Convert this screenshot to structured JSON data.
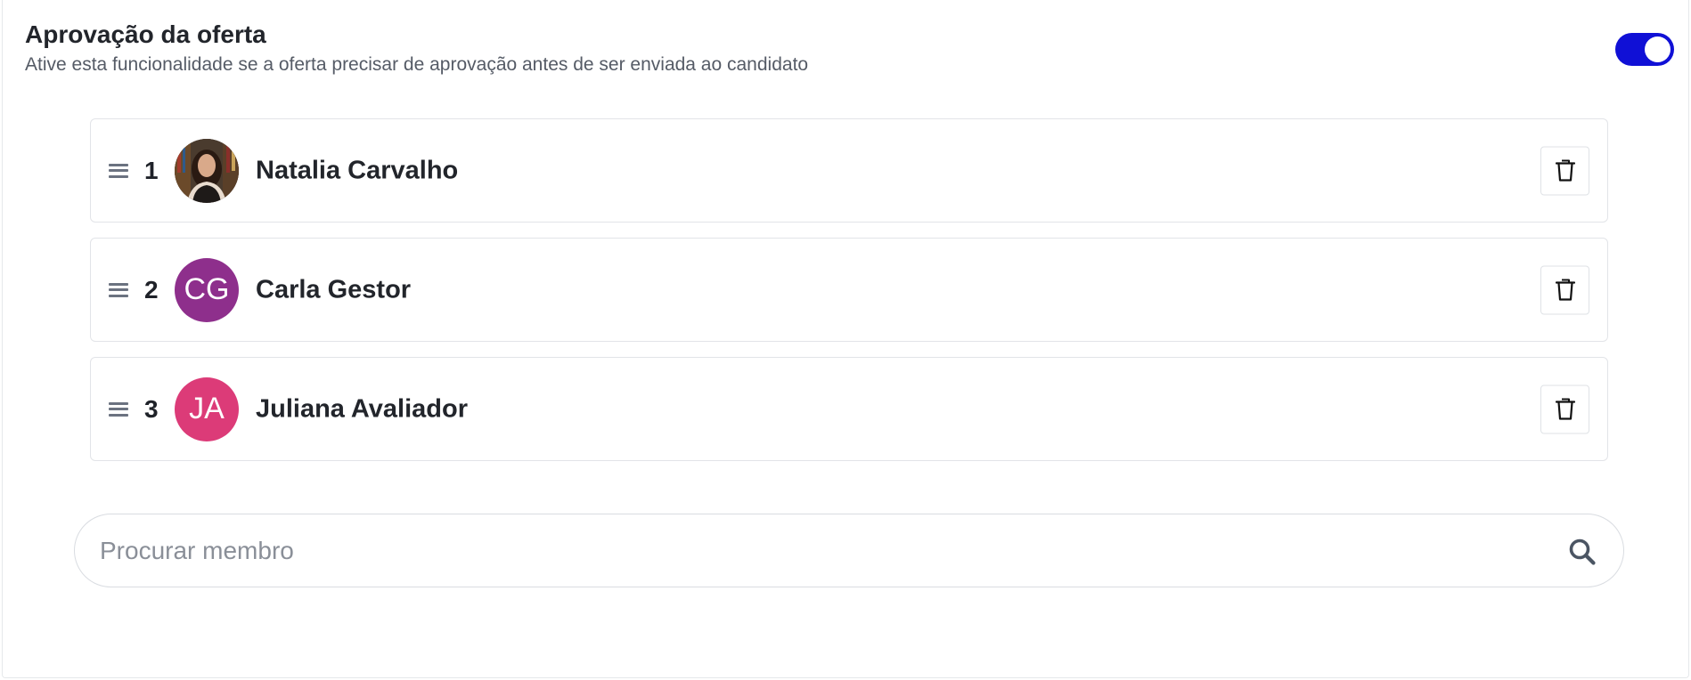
{
  "section": {
    "title": "Aprovação da oferta",
    "subtitle": "Ative esta funcionalidade se a oferta precisar de aprovação antes de ser enviada ao candidato",
    "toggle_on": true
  },
  "approvers": [
    {
      "order": "1",
      "name": "Natalia Carvalho",
      "avatar_type": "photo",
      "initials": "",
      "avatar_color": "#3a2a22"
    },
    {
      "order": "2",
      "name": "Carla Gestor",
      "avatar_type": "initials",
      "initials": "CG",
      "avatar_color": "#8e2f8c"
    },
    {
      "order": "3",
      "name": "Juliana Avaliador",
      "avatar_type": "initials",
      "initials": "JA",
      "avatar_color": "#dc3b78"
    }
  ],
  "search": {
    "placeholder": "Procurar membro",
    "value": ""
  },
  "colors": {
    "toggle_on": "#1010d6"
  }
}
